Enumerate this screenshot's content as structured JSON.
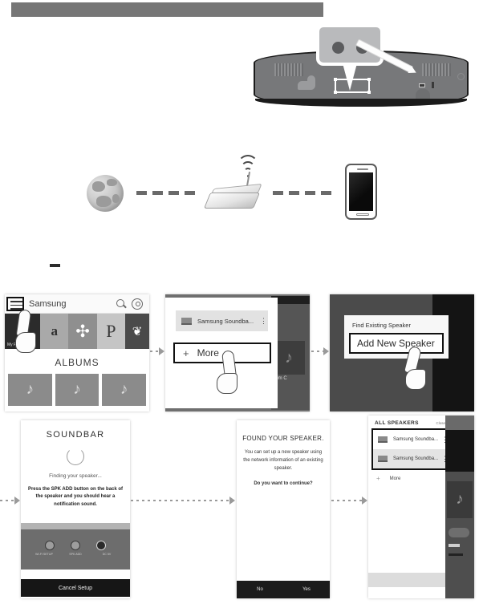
{
  "header": {
    "bar_color": "#767676"
  },
  "hardware": {
    "soundbar_callout": {
      "name": "soundbar-rear-port-zoom",
      "buttons": [
        "spk-add-button-left",
        "spk-add-button-right"
      ],
      "pointer": "stylus-pointer"
    }
  },
  "network_diagram": {
    "nodes": [
      "internet-globe",
      "wireless-router",
      "mobile-phone"
    ],
    "connection_style": "dashed"
  },
  "steps": [
    {
      "id": "panel1",
      "name": "samsung-music-app",
      "appbar": {
        "title": "Samsung",
        "menu_icon": "hamburger-menu-icon",
        "search_icon": "search-icon",
        "settings_icon": "gear-icon"
      },
      "tiles": [
        {
          "label": "My Phone",
          "icon": "phone-icon"
        },
        {
          "label": "a",
          "icon": "amazon-icon"
        },
        {
          "label": "✣",
          "icon": "deezer-icon"
        },
        {
          "label": "P",
          "icon": "pandora-icon"
        },
        {
          "label": "❦",
          "icon": "iheartradio-icon"
        }
      ],
      "section_title": "ALBUMS",
      "album_tiles": [
        "♪",
        "♪",
        "♪"
      ]
    },
    {
      "id": "panel2",
      "name": "speaker-list-sheet",
      "speaker_item": "Samsung Soundba...",
      "more_button": "More",
      "more_plus": "+",
      "background_caption": "bum C",
      "kebab": "⋮"
    },
    {
      "id": "panel3",
      "name": "add-speaker-dialog",
      "find_existing": "Find Existing Speaker",
      "add_new": "Add New Speaker"
    },
    {
      "id": "panel4",
      "name": "soundbar-finding-screen",
      "title": "SOUNDBAR",
      "status": "Finding your speaker...",
      "instruction": "Press the SPK ADD button on the back of the speaker and you should hear a notification sound.",
      "knob_labels": [
        "WI-FI SETUP",
        "SPK ADD",
        "DC 5V"
      ],
      "cancel_button": "Cancel Setup"
    },
    {
      "id": "panel5",
      "name": "found-speaker-dialog",
      "title": "FOUND YOUR SPEAKER.",
      "description": "You can set up a new speaker using the network information of an existing speaker.",
      "question": "Do you want to continue?",
      "no_button": "No",
      "yes_button": "Yes"
    },
    {
      "id": "panel6",
      "name": "all-speakers-list",
      "header": "ALL SPEAKERS",
      "close_link": "Close",
      "rows": [
        "Samsung Soundba...",
        "Samsung Soundba..."
      ],
      "more_label": "More",
      "more_plus": "+",
      "kebab": "⋮"
    }
  ]
}
